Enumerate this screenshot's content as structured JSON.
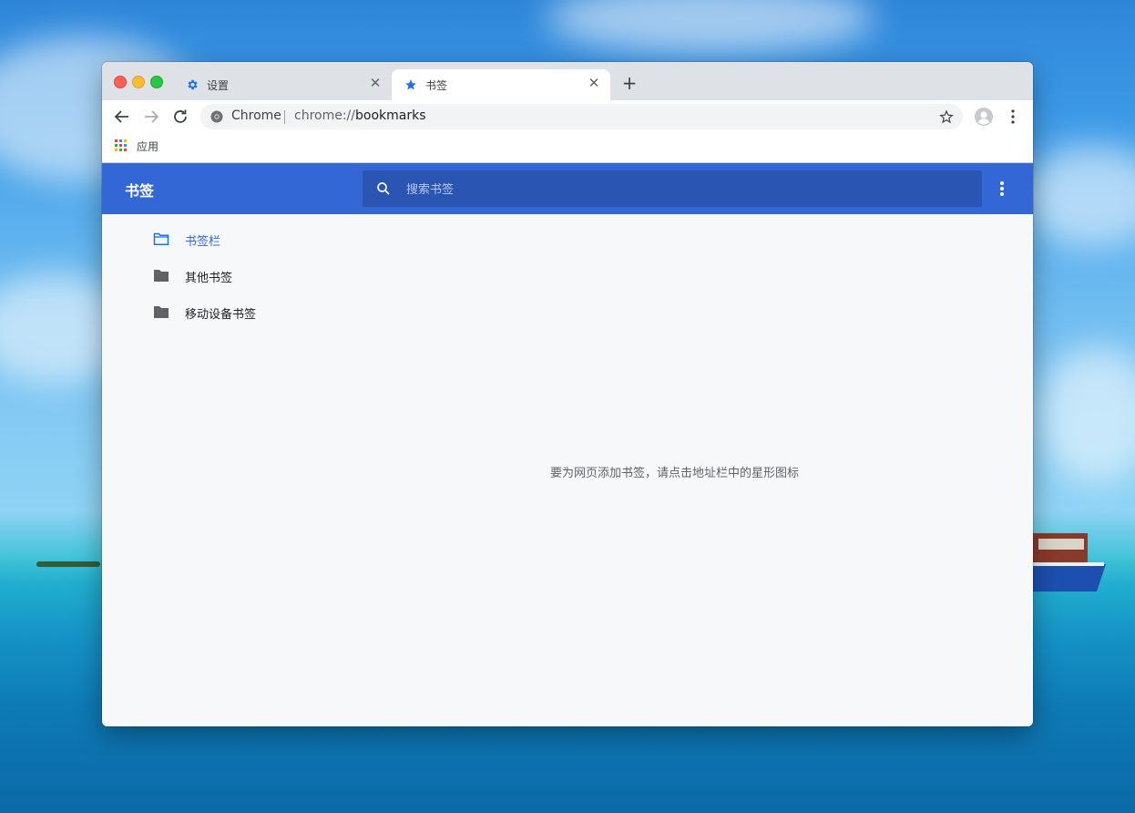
{
  "tabs": [
    {
      "label": "设置",
      "icon": "gear-icon",
      "active": false
    },
    {
      "label": "书签",
      "icon": "star-icon",
      "active": true
    }
  ],
  "toolbar": {
    "site_label": "Chrome",
    "url_scheme": "chrome://",
    "url_path": "bookmarks"
  },
  "bookmarks_bar": {
    "apps_label": "应用"
  },
  "bookmarks_page": {
    "title": "书签",
    "search_placeholder": "搜索书签",
    "folders": [
      {
        "label": "书签栏",
        "selected": true
      },
      {
        "label": "其他书签",
        "selected": false
      },
      {
        "label": "移动设备书签",
        "selected": false
      }
    ],
    "empty_message": "要为网页添加书签，请点击地址栏中的星形图标"
  },
  "colors": {
    "header_blue": "#3367d6",
    "search_blue": "#2a55b3",
    "link_blue": "#1a73e8"
  }
}
